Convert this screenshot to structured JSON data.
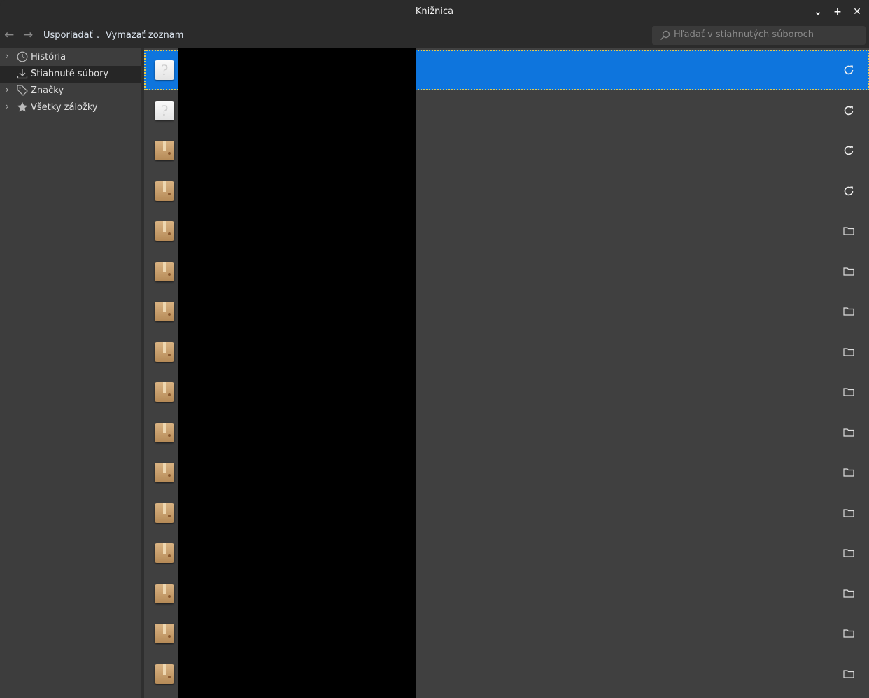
{
  "window": {
    "title": "Knižnica"
  },
  "toolbar": {
    "organize_label": "Usporiadať",
    "clear_label": "Vymazať zoznam"
  },
  "search": {
    "placeholder": "Hľadať v stiahnutých súboroch"
  },
  "sidebar": {
    "items": [
      {
        "label": "História",
        "icon": "clock-icon",
        "expandable": true,
        "selected": false
      },
      {
        "label": "Stiahnuté súbory",
        "icon": "download-icon",
        "expandable": false,
        "selected": true
      },
      {
        "label": "Značky",
        "icon": "tag-icon",
        "expandable": true,
        "selected": false
      },
      {
        "label": "Všetky záložky",
        "icon": "star-icon",
        "expandable": true,
        "selected": false
      }
    ]
  },
  "downloads": [
    {
      "file_icon": "unknown",
      "action": "retry",
      "selected": true
    },
    {
      "file_icon": "unknown",
      "action": "retry"
    },
    {
      "file_icon": "package",
      "action": "retry"
    },
    {
      "file_icon": "package",
      "action": "retry"
    },
    {
      "file_icon": "package",
      "action": "folder"
    },
    {
      "file_icon": "package",
      "action": "folder"
    },
    {
      "file_icon": "package",
      "action": "folder"
    },
    {
      "file_icon": "package",
      "action": "folder"
    },
    {
      "file_icon": "package",
      "action": "folder"
    },
    {
      "file_icon": "package",
      "action": "folder"
    },
    {
      "file_icon": "package",
      "action": "folder"
    },
    {
      "file_icon": "package",
      "action": "folder"
    },
    {
      "file_icon": "package",
      "action": "folder"
    },
    {
      "file_icon": "package",
      "action": "folder"
    },
    {
      "file_icon": "package",
      "action": "folder"
    },
    {
      "file_icon": "package",
      "action": "folder"
    }
  ]
}
